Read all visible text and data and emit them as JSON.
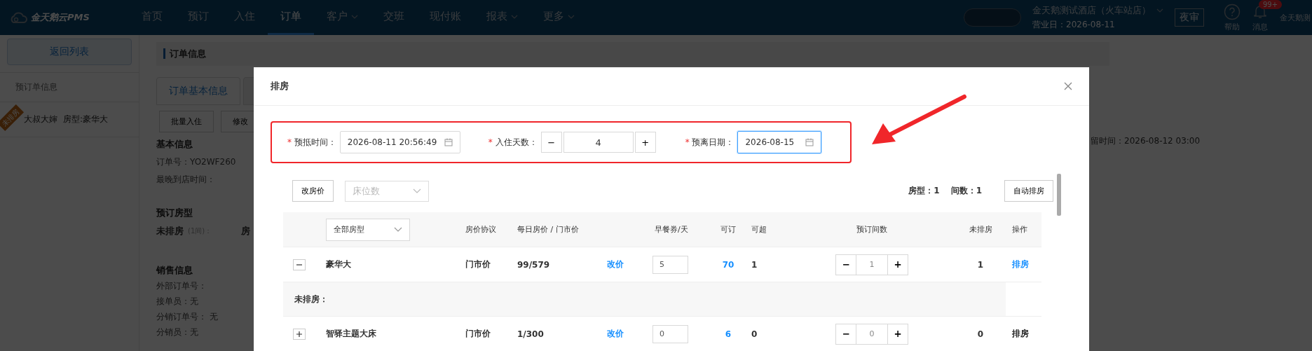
{
  "top_bar": {
    "logo": "金天鹅云PMS",
    "nav": [
      {
        "label": "首页",
        "selected": false,
        "has_menu": false
      },
      {
        "label": "预订",
        "selected": false,
        "has_menu": false
      },
      {
        "label": "入住",
        "selected": false,
        "has_menu": false
      },
      {
        "label": "订单",
        "selected": true,
        "has_menu": false
      },
      {
        "label": "客户",
        "selected": false,
        "has_menu": true
      },
      {
        "label": "交班",
        "selected": false,
        "has_menu": false
      },
      {
        "label": "现付账",
        "selected": false,
        "has_menu": false
      },
      {
        "label": "报表",
        "selected": false,
        "has_menu": true
      },
      {
        "label": "更多",
        "selected": false,
        "has_menu": true
      }
    ],
    "hotel_name": "金天鹅测试酒店（火车站店）",
    "business_date": "营业日：2026-08-11",
    "night_audit_button": "夜审",
    "help": "帮助",
    "messages": "消息",
    "message_badge": "99+",
    "user": "金天鹅测"
  },
  "sidebar": {
    "back_button": "返回列表",
    "items": [
      {
        "kind": "plain",
        "label": "预订单信息"
      },
      {
        "kind": "order",
        "ribbon": "未排房",
        "guest": "大叔大婶",
        "room_type": "房型:豪华大"
      }
    ]
  },
  "order_panel": {
    "header": "订单信息",
    "tabs": [
      {
        "label": "订单基本信息",
        "selected": true
      }
    ],
    "buttons": [
      "批量入住",
      "修改"
    ],
    "basic_info": {
      "title": "基本信息",
      "lines": [
        "订单号：YO2WF260",
        "最晚到店时间："
      ],
      "retention_time": "留时间：2026-08-12 03:00"
    },
    "room_types": {
      "title": "预订房型",
      "status": "未排房",
      "count": "(1间)：",
      "room": "房"
    },
    "sales_info": {
      "title": "销售信息",
      "lines": [
        "外部订单号：",
        "接单员：无",
        "分销订单号：  无",
        "分销员：无"
      ]
    }
  },
  "modal": {
    "title": "排房",
    "fields": [
      {
        "kind": "datetime",
        "mark": "*",
        "label": "预抵时间：",
        "value": "2026-08-11 20:56:49",
        "focused": false
      },
      {
        "kind": "stepper",
        "mark": "*",
        "label": "入住天数：",
        "value": "4",
        "minus": "−",
        "plus": "+"
      },
      {
        "kind": "date",
        "mark": "*",
        "label": "预离日期：",
        "value": "2026-08-15",
        "focused": true
      }
    ],
    "change_price_button": "改房价",
    "bed_select": {
      "placeholder": "床位数"
    },
    "summary": [
      "房型：1",
      "间数：1"
    ],
    "auto_assign_button": "自动排房",
    "table": {
      "room_type_filter": "全部房型",
      "columns": [
        "房价协议",
        "每日房价 / 门市价",
        "早餐券/天",
        "可订",
        "可超",
        "预订间数",
        "未排房",
        "操作"
      ],
      "rows": [
        {
          "kind": "room_type",
          "expanded": true,
          "name": "豪华大",
          "rate_plan": "门市价",
          "price": "99/579",
          "change_price": "改价",
          "breakfast": "5",
          "available": "70",
          "overbook": "1",
          "minus": "−",
          "rooms": "1",
          "plus": "+",
          "unassigned": "1",
          "action": "排房",
          "action_enabled": true
        },
        {
          "kind": "group_header",
          "label": "未排房："
        },
        {
          "kind": "room_type",
          "expanded": false,
          "name": "智驿主题大床",
          "rate_plan": "门市价",
          "price": "1/300",
          "change_price": "改价",
          "breakfast": "0",
          "available": "6",
          "overbook": "0",
          "minus": "−",
          "rooms": "0",
          "plus": "+",
          "unassigned": "0",
          "action": "排房",
          "action_enabled": false
        }
      ]
    }
  }
}
